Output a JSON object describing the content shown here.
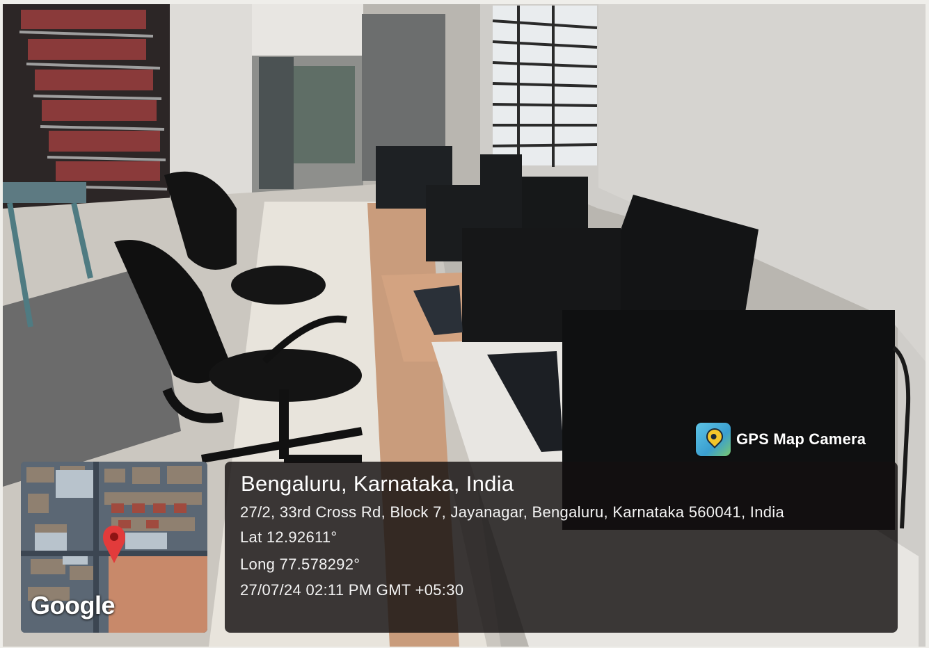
{
  "scene": {
    "description_icon": "computer-lab-photo"
  },
  "badge": {
    "app_name": "GPS Map Camera",
    "icon": "gps-map-camera-icon"
  },
  "map": {
    "logo": "Google",
    "pin_color": "#e23b3b"
  },
  "location": {
    "title": "Bengaluru, Karnataka, India",
    "address": "27/2, 33rd Cross Rd, Block 7, Jayanagar, Bengaluru, Karnataka 560041, India",
    "lat": "Lat 12.92611°",
    "long": "Long 77.578292°",
    "datetime": "27/07/24 02:11 PM GMT +05:30"
  }
}
